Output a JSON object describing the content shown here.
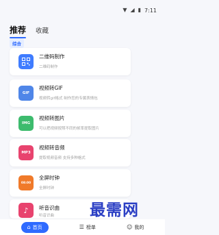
{
  "status_bar": {
    "time": "7:11",
    "icons": [
      "wifi-icon",
      "signal-icon",
      "battery-icon"
    ]
  },
  "tabs": [
    {
      "label": "推荐",
      "active": true
    },
    {
      "label": "收藏",
      "active": false
    }
  ],
  "category": {
    "label": "综合"
  },
  "tools": [
    {
      "title": "二维码制作",
      "subtitle": "二维码制作",
      "icon": "qr-code-icon",
      "icon_text": "",
      "color": "#3f7cff"
    },
    {
      "title": "视频转GIF",
      "subtitle": "视频转gif格式 制作您的专属表情包",
      "icon": "gif-icon",
      "icon_text": "GIF",
      "color": "#4f86e8"
    },
    {
      "title": "视频转图片",
      "subtitle": "可以把视频按照不同的帧率提取图片",
      "icon": "image-icon",
      "icon_text": "IMG",
      "color": "#3dbb6d"
    },
    {
      "title": "视频转音频",
      "subtitle": "提取视频音频 支持多种格式",
      "icon": "mp3-icon",
      "icon_text": "MP3",
      "color": "#e8436e"
    },
    {
      "title": "全屏时钟",
      "subtitle": "全屏时钟",
      "icon": "clock-icon",
      "icon_text": "08:00",
      "color": "#f07a2a"
    },
    {
      "title": "听音识曲",
      "subtitle": "听音识曲",
      "icon": "music-icon",
      "icon_text": "",
      "color": "#e8436e"
    }
  ],
  "bottom_nav": [
    {
      "label": "首页",
      "icon": "home-icon",
      "active": true
    },
    {
      "label": "榜单",
      "icon": "list-icon",
      "active": false
    },
    {
      "label": "我的",
      "icon": "user-icon",
      "active": false
    }
  ],
  "watermark": {
    "text": "最需网",
    "color": "#2b3fc4"
  },
  "colors": {
    "accent": "#2f6bff",
    "background": "#f6f7fb"
  }
}
